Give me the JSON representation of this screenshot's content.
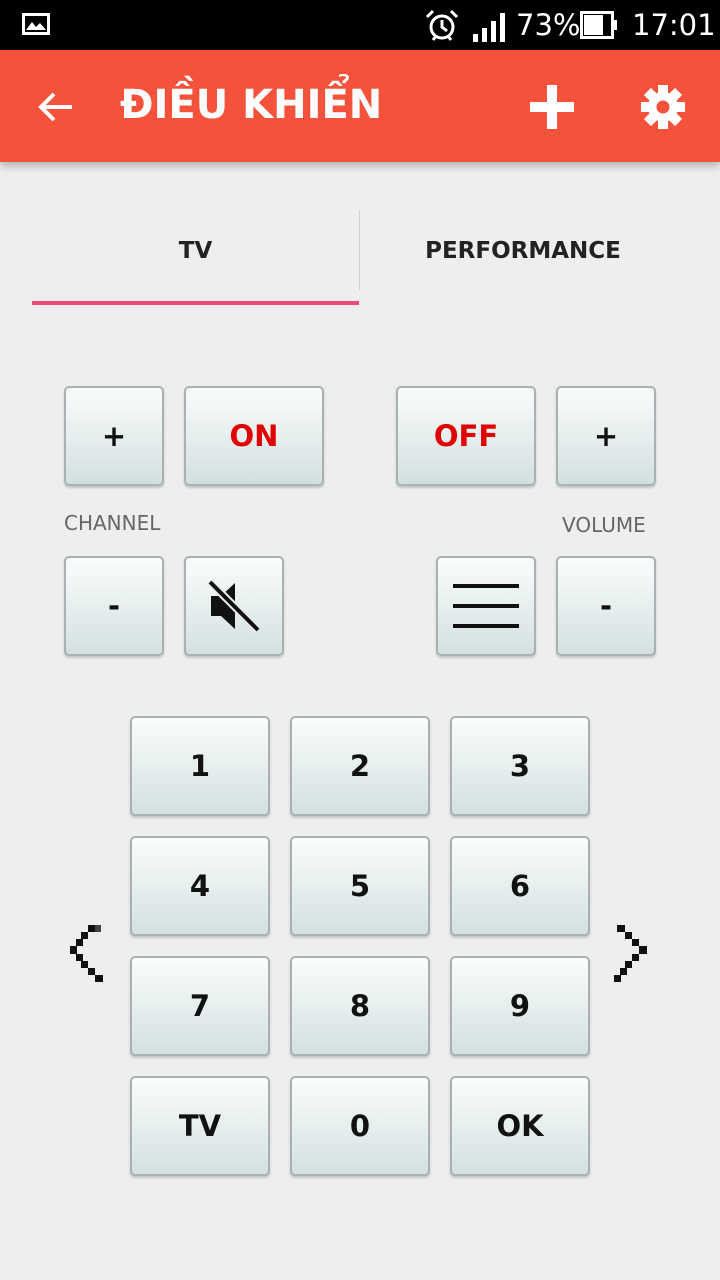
{
  "status_bar": {
    "battery_percent": "73%",
    "time": "17:01",
    "icons": [
      "gallery-icon",
      "alarm-icon",
      "signal-icon",
      "battery-icon"
    ]
  },
  "app_bar": {
    "title": "ĐIỀU KHIỂN",
    "color": "#f4523b",
    "icons": [
      "back-arrow-icon",
      "plus-icon",
      "gear-icon"
    ]
  },
  "tabs": [
    {
      "label": "TV",
      "selected": true
    },
    {
      "label": "PERFORMANCE",
      "selected": false
    }
  ],
  "tab_indicator_color": "#ea4a72",
  "controls": {
    "channel_up": "+",
    "power_on": "ON",
    "power_off": "OFF",
    "volume_up": "+",
    "channel_label": "CHANNEL",
    "volume_label": "VOLUME",
    "channel_down": "-",
    "volume_down": "-",
    "mute_icon": "mute-icon",
    "menu_icon": "menu-icon",
    "power_text_color": "#e10000"
  },
  "keypad": {
    "keys": [
      "1",
      "2",
      "3",
      "4",
      "5",
      "6",
      "7",
      "8",
      "9",
      "TV",
      "0",
      "OK"
    ]
  },
  "navigation": {
    "prev_icon": "chevron-left-icon",
    "next_icon": "chevron-right-icon"
  }
}
